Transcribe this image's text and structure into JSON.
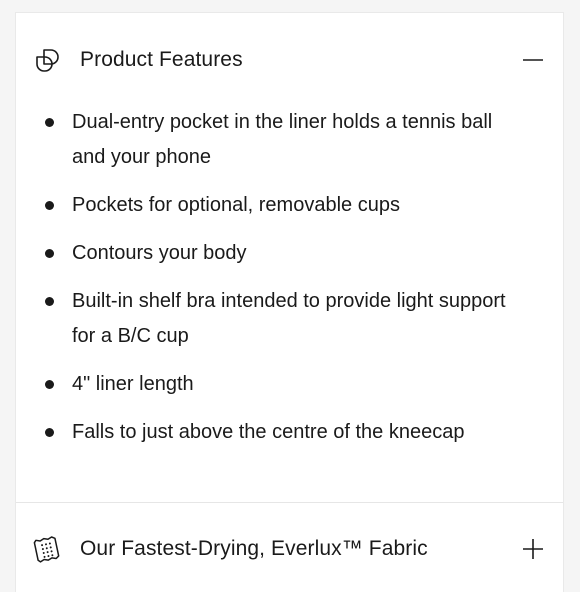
{
  "sections": [
    {
      "title": "Product Features",
      "icon": "overlapping-shapes-icon",
      "expanded": true,
      "toggle": "minus",
      "items": [
        "Dual-entry pocket in the liner holds a tennis ball and your phone",
        "Pockets for optional, removable cups",
        "Contours your body",
        "Built-in shelf bra intended to provide light support for a B/C cup",
        "4\" liner length",
        "Falls to just above the centre of the kneecap"
      ]
    },
    {
      "title": "Our Fastest-Drying, Everlux™ Fabric",
      "icon": "fabric-swatch-icon",
      "expanded": false,
      "toggle": "plus"
    }
  ],
  "colors": {
    "text": "#1a1a1a",
    "divider": "#e6e6e6",
    "background": "#f5f5f5",
    "panel": "#ffffff"
  }
}
